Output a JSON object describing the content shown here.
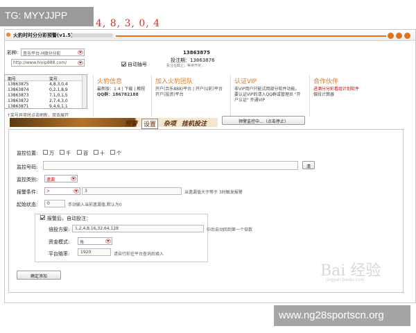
{
  "badge": {
    "top_left": "TG: MYYJJPP"
  },
  "window": {
    "title": "火豹时时分分彩预警(v1.5)"
  },
  "left": {
    "type_label": "彩种:",
    "type_value": "音乐平台-H微分分彩",
    "url_value": "http://www.hivip888.com/",
    "table_headers": [
      "期号",
      "奖号"
    ],
    "rows": [
      [
        "13863875",
        "4,8,3,0,4"
      ],
      [
        "13863874",
        "0,2,1,8,9"
      ],
      [
        "13863873",
        "7,1,0,1,5"
      ],
      [
        "13863872",
        "2,7,4,3,0"
      ],
      [
        "13863871",
        "9,4,6,1,1"
      ]
    ]
  },
  "draw": {
    "numbers": "4, 8, 3, 0, 4",
    "issue": "13863875",
    "issue_line": "投注期：13863876",
    "sub_line": "投注在截止，等待开奖...",
    "auto_label": "自动抽号"
  },
  "info": {
    "col1": {
      "title": "火豹信息",
      "line1": "最新版：1.4 | 下载 | 教程",
      "line2": "QQ群：186782188"
    },
    "col2": {
      "title": "加入火豹团队",
      "line1": "开户(合乐888)平台 | 开户(U彩)平台",
      "line2": "开户(投资)平台"
    },
    "col3": {
      "title": "认证VIP",
      "line1": "非VIP用户只能试用部分软件功能。",
      "line2": "要认证VIP的请入QQ群或管理员 \"开",
      "line3": "户认证\" 开通VIP"
    },
    "col4": {
      "title": "合作伙伴",
      "line1": "进酒分分彩看组计划软件",
      "line2": "做段计算器"
    }
  },
  "tip": "↑奖号异常时点击刷新，双击展开",
  "tabs": {
    "t1": "预警",
    "t2": "设置",
    "t3": "杂项",
    "t4": "挂机投注"
  },
  "monitor_button": "预警监控中...（点击停止）",
  "form": {
    "position_label": "监控位置:",
    "positions": [
      "万",
      "千",
      "百",
      "十",
      "个"
    ],
    "number_label": "监控号码:",
    "clear_button": "清",
    "type_label": "监控类别:",
    "type_value": "遗漏",
    "cond_label": "报警条件:",
    "cond_op": ">",
    "cond_value": "3",
    "cond_hint": "当遗漏值大于等于 3时触发报警",
    "start_label": "起始状态:",
    "start_value": "0",
    "start_hint": "手动输入当前遗漏值,默认为0",
    "auto_label": "报警后，自动投注：",
    "plan_label": "倍投方案:",
    "plan_value": "1,2,4,8,16,32,64,128",
    "plan_hint": "中后自动回到第一个倍数",
    "mode_label": "资金模式:",
    "mode_value": "角",
    "rate_label": "平台赔率:",
    "rate_value": "1920",
    "rate_hint": "请自行前往平台查询后填入",
    "confirm_button": "确定添加"
  },
  "watermarks": {
    "baidu": "Bai 经验",
    "baidu_sub": "jingyan.baidu.com",
    "bottom_right": "www.ng28sportscn.org"
  },
  "colors": {
    "accent_orange": "#e3721b",
    "numbers_red": "#d62b2b"
  }
}
